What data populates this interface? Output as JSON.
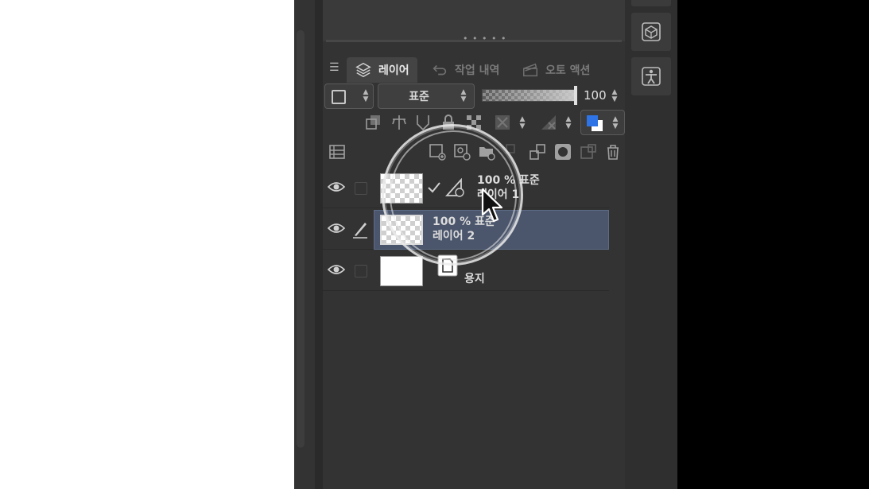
{
  "tabs": {
    "layer": "레이어",
    "history": "작업 내역",
    "auto_action": "오토 액션"
  },
  "blend_mode": "표준",
  "opacity_value": "100",
  "opacity_fraction": 1.0,
  "layers": [
    {
      "percent_mode": "100 % 표준",
      "name": "레이어 1",
      "selected": false,
      "thumbnail": "checker"
    },
    {
      "percent_mode": "100 % 표준",
      "name": "레이어 2",
      "selected": true,
      "thumbnail": "checker"
    },
    {
      "percent_mode": "",
      "name": "용지",
      "selected": false,
      "thumbnail": "paper"
    }
  ],
  "colors": {
    "panel_bg": "#333333",
    "selected_row": "#4b566c",
    "accent_blue": "#2f74e6"
  },
  "icons": [
    "menu-icon",
    "layer-stack-icon",
    "undo-icon",
    "auto-action-icon",
    "eye-icon",
    "pen-icon",
    "trash-icon",
    "cube-icon",
    "figure-icon"
  ]
}
